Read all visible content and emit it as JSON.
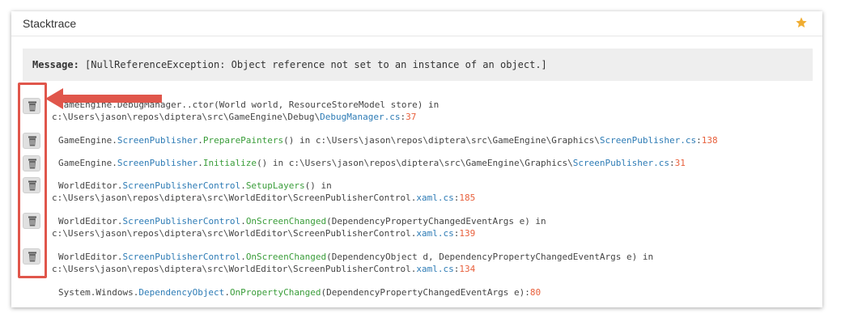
{
  "panel": {
    "title": "Stacktrace",
    "star_icon": "star-icon",
    "star_color": "#f0ad32"
  },
  "message": {
    "label": "Message:",
    "text": "[NullReferenceException: Object reference not set to an instance of an object.]"
  },
  "frames": [
    {
      "ns": "GameEngine.",
      "type": "DebugManager",
      "method": "..ctor",
      "args": "(World world, ResourceStoreModel store) in",
      "path": "c:\\Users\\jason\\repos\\diptera\\src\\GameEngine\\Debug\\",
      "file": "DebugManager.cs",
      "sep": ":",
      "line": "37"
    },
    {
      "ns": "GameEngine.",
      "type": "ScreenPublisher",
      "dot": ".",
      "method": "PreparePainters",
      "args": "() in c:\\Users\\jason\\repos\\diptera\\src\\GameEngine\\Graphics\\",
      "file": "ScreenPublisher.cs",
      "sep": ":",
      "line": "138"
    },
    {
      "ns": "GameEngine.",
      "type": "ScreenPublisher",
      "dot": ".",
      "method": "Initialize",
      "args": "() in c:\\Users\\jason\\repos\\diptera\\src\\GameEngine\\Graphics\\",
      "file": "ScreenPublisher.cs",
      "sep": ":",
      "line": "31"
    },
    {
      "ns": "WorldEditor.",
      "type": "ScreenPublisherControl",
      "dot": ".",
      "method": "SetupLayers",
      "args": "() in",
      "path": "c:\\Users\\jason\\repos\\diptera\\src\\WorldEditor\\ScreenPublisherControl.",
      "file": "xaml.cs",
      "sep": ":",
      "line": "185"
    },
    {
      "ns": "WorldEditor.",
      "type": "ScreenPublisherControl",
      "dot": ".",
      "method": "OnScreenChanged",
      "args": "(DependencyPropertyChangedEventArgs e) in",
      "path": "c:\\Users\\jason\\repos\\diptera\\src\\WorldEditor\\ScreenPublisherControl.",
      "file": "xaml.cs",
      "sep": ":",
      "line": "139"
    },
    {
      "ns": "WorldEditor.",
      "type": "ScreenPublisherControl",
      "dot": ".",
      "method": "OnScreenChanged",
      "args": "(DependencyObject d, DependencyPropertyChangedEventArgs e) in",
      "path": "c:\\Users\\jason\\repos\\diptera\\src\\WorldEditor\\ScreenPublisherControl.",
      "file": "xaml.cs",
      "sep": ":",
      "line": "134"
    },
    {
      "ns": "System.Windows.",
      "type": "DependencyObject",
      "dot": ".",
      "method": "OnPropertyChanged",
      "args": "(DependencyPropertyChangedEventArgs e)",
      "sep": ":",
      "line": "80"
    }
  ],
  "copy_button_icon": "trash-icon",
  "annotation": {
    "color": "#e0564b",
    "arrow_icon": "arrow-left-icon"
  }
}
